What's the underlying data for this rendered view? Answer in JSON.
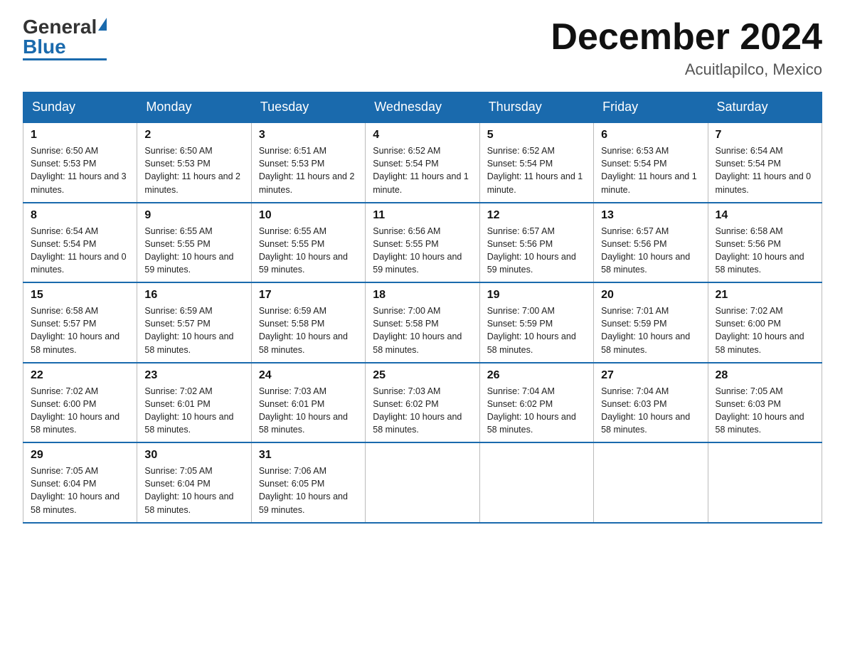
{
  "header": {
    "logo_general": "General",
    "logo_blue": "Blue",
    "month_title": "December 2024",
    "location": "Acuitlapilco, Mexico"
  },
  "weekdays": [
    "Sunday",
    "Monday",
    "Tuesday",
    "Wednesday",
    "Thursday",
    "Friday",
    "Saturday"
  ],
  "weeks": [
    [
      {
        "day": "1",
        "sunrise": "6:50 AM",
        "sunset": "5:53 PM",
        "daylight": "11 hours and 3 minutes."
      },
      {
        "day": "2",
        "sunrise": "6:50 AM",
        "sunset": "5:53 PM",
        "daylight": "11 hours and 2 minutes."
      },
      {
        "day": "3",
        "sunrise": "6:51 AM",
        "sunset": "5:53 PM",
        "daylight": "11 hours and 2 minutes."
      },
      {
        "day": "4",
        "sunrise": "6:52 AM",
        "sunset": "5:54 PM",
        "daylight": "11 hours and 1 minute."
      },
      {
        "day": "5",
        "sunrise": "6:52 AM",
        "sunset": "5:54 PM",
        "daylight": "11 hours and 1 minute."
      },
      {
        "day": "6",
        "sunrise": "6:53 AM",
        "sunset": "5:54 PM",
        "daylight": "11 hours and 1 minute."
      },
      {
        "day": "7",
        "sunrise": "6:54 AM",
        "sunset": "5:54 PM",
        "daylight": "11 hours and 0 minutes."
      }
    ],
    [
      {
        "day": "8",
        "sunrise": "6:54 AM",
        "sunset": "5:54 PM",
        "daylight": "11 hours and 0 minutes."
      },
      {
        "day": "9",
        "sunrise": "6:55 AM",
        "sunset": "5:55 PM",
        "daylight": "10 hours and 59 minutes."
      },
      {
        "day": "10",
        "sunrise": "6:55 AM",
        "sunset": "5:55 PM",
        "daylight": "10 hours and 59 minutes."
      },
      {
        "day": "11",
        "sunrise": "6:56 AM",
        "sunset": "5:55 PM",
        "daylight": "10 hours and 59 minutes."
      },
      {
        "day": "12",
        "sunrise": "6:57 AM",
        "sunset": "5:56 PM",
        "daylight": "10 hours and 59 minutes."
      },
      {
        "day": "13",
        "sunrise": "6:57 AM",
        "sunset": "5:56 PM",
        "daylight": "10 hours and 58 minutes."
      },
      {
        "day": "14",
        "sunrise": "6:58 AM",
        "sunset": "5:56 PM",
        "daylight": "10 hours and 58 minutes."
      }
    ],
    [
      {
        "day": "15",
        "sunrise": "6:58 AM",
        "sunset": "5:57 PM",
        "daylight": "10 hours and 58 minutes."
      },
      {
        "day": "16",
        "sunrise": "6:59 AM",
        "sunset": "5:57 PM",
        "daylight": "10 hours and 58 minutes."
      },
      {
        "day": "17",
        "sunrise": "6:59 AM",
        "sunset": "5:58 PM",
        "daylight": "10 hours and 58 minutes."
      },
      {
        "day": "18",
        "sunrise": "7:00 AM",
        "sunset": "5:58 PM",
        "daylight": "10 hours and 58 minutes."
      },
      {
        "day": "19",
        "sunrise": "7:00 AM",
        "sunset": "5:59 PM",
        "daylight": "10 hours and 58 minutes."
      },
      {
        "day": "20",
        "sunrise": "7:01 AM",
        "sunset": "5:59 PM",
        "daylight": "10 hours and 58 minutes."
      },
      {
        "day": "21",
        "sunrise": "7:02 AM",
        "sunset": "6:00 PM",
        "daylight": "10 hours and 58 minutes."
      }
    ],
    [
      {
        "day": "22",
        "sunrise": "7:02 AM",
        "sunset": "6:00 PM",
        "daylight": "10 hours and 58 minutes."
      },
      {
        "day": "23",
        "sunrise": "7:02 AM",
        "sunset": "6:01 PM",
        "daylight": "10 hours and 58 minutes."
      },
      {
        "day": "24",
        "sunrise": "7:03 AM",
        "sunset": "6:01 PM",
        "daylight": "10 hours and 58 minutes."
      },
      {
        "day": "25",
        "sunrise": "7:03 AM",
        "sunset": "6:02 PM",
        "daylight": "10 hours and 58 minutes."
      },
      {
        "day": "26",
        "sunrise": "7:04 AM",
        "sunset": "6:02 PM",
        "daylight": "10 hours and 58 minutes."
      },
      {
        "day": "27",
        "sunrise": "7:04 AM",
        "sunset": "6:03 PM",
        "daylight": "10 hours and 58 minutes."
      },
      {
        "day": "28",
        "sunrise": "7:05 AM",
        "sunset": "6:03 PM",
        "daylight": "10 hours and 58 minutes."
      }
    ],
    [
      {
        "day": "29",
        "sunrise": "7:05 AM",
        "sunset": "6:04 PM",
        "daylight": "10 hours and 58 minutes."
      },
      {
        "day": "30",
        "sunrise": "7:05 AM",
        "sunset": "6:04 PM",
        "daylight": "10 hours and 58 minutes."
      },
      {
        "day": "31",
        "sunrise": "7:06 AM",
        "sunset": "6:05 PM",
        "daylight": "10 hours and 59 minutes."
      },
      null,
      null,
      null,
      null
    ]
  ],
  "labels": {
    "sunrise": "Sunrise:",
    "sunset": "Sunset:",
    "daylight": "Daylight:"
  }
}
